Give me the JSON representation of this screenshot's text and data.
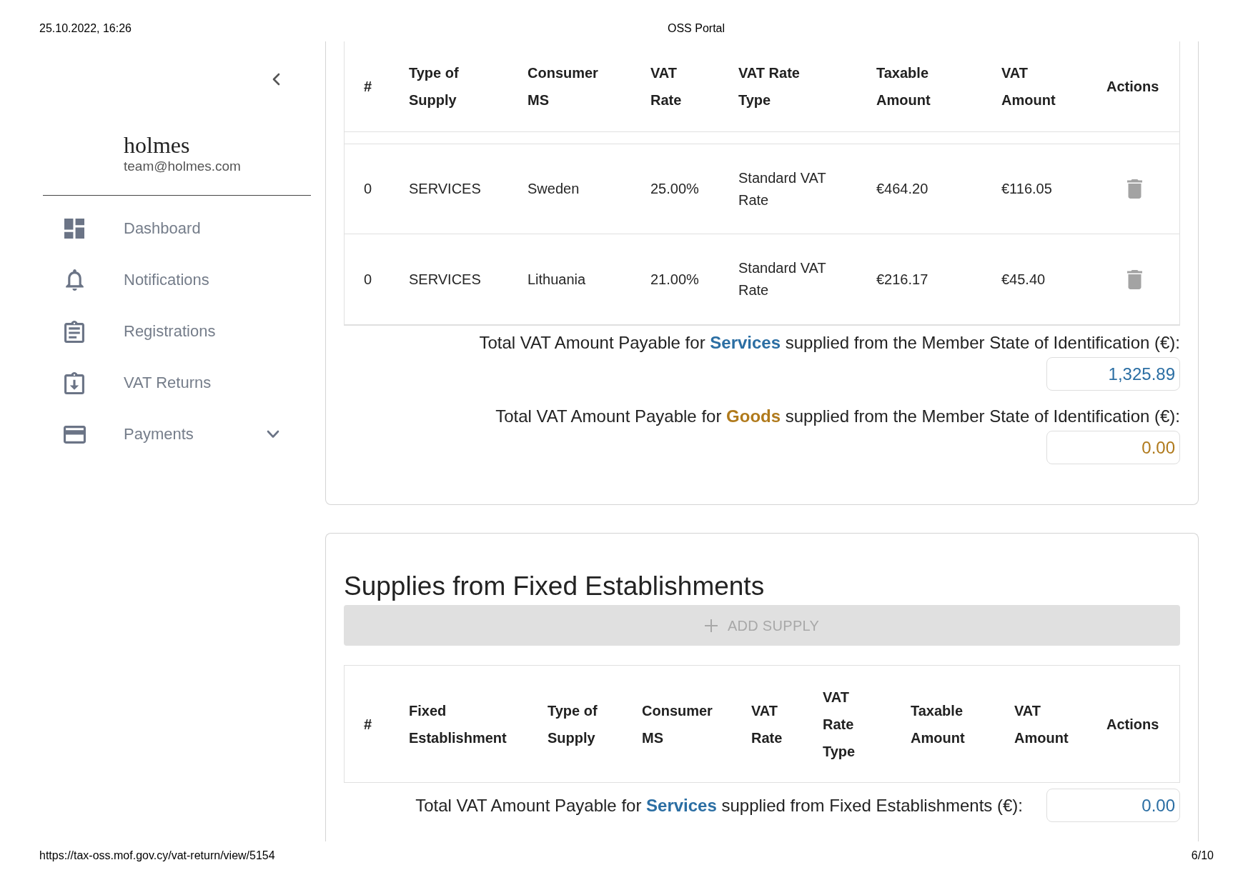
{
  "print_header": {
    "datetime": "25.10.2022, 16:26",
    "title": "OSS Portal"
  },
  "sidebar": {
    "user": {
      "name": "holmes",
      "email": "team@holmes.com"
    },
    "nav_items": [
      {
        "label": "Dashboard",
        "kind": "link"
      },
      {
        "label": "Notifications",
        "kind": "link"
      },
      {
        "label": "Registrations",
        "kind": "link"
      },
      {
        "label": "VAT Returns",
        "kind": "link"
      },
      {
        "label": "Payments",
        "kind": "group",
        "expanded": false
      }
    ]
  },
  "supplies_from_msi": {
    "table": {
      "columns": [
        "#",
        "Type of Supply",
        "Consumer MS",
        "VAT Rate",
        "VAT Rate Type",
        "Taxable Amount",
        "VAT Amount",
        "Actions"
      ],
      "rows": [
        [
          "0",
          "SERVICES",
          "Sweden",
          "25.00%",
          "Standard VAT Rate",
          "€464.20",
          "€116.05"
        ],
        [
          "0",
          "SERVICES",
          "Lithuania",
          "21.00%",
          "Standard VAT Rate",
          "€216.17",
          "€45.40"
        ]
      ]
    },
    "totals": [
      {
        "kind": "services",
        "label": "Total VAT Amount Payable for **Services** supplied from the Member State of Identification (€):",
        "value": "1,325.89"
      },
      {
        "kind": "goods",
        "label": "Total VAT Amount Payable for **Goods** supplied from the Member State of Identification (€):",
        "value": "0.00"
      }
    ]
  },
  "supplies_from_fixed_establishments": {
    "title": "Supplies from Fixed Establishments",
    "add_button": {
      "label": "ADD SUPPLY",
      "disabled": true
    },
    "table": {
      "columns": [
        "#",
        "Fixed Establishment",
        "Type of Supply",
        "Consumer MS",
        "VAT Rate",
        "VAT Rate Type",
        "Taxable Amount",
        "VAT Amount",
        "Actions"
      ]
    },
    "totals": [
      {
        "kind": "services",
        "label": "Total VAT Amount Payable for **Services** supplied from Fixed Establishments (€):",
        "value": "0.00"
      }
    ]
  },
  "print_footer": {
    "url": "https://tax-oss.mof.gov.cy/vat-return/view/5154",
    "page": "6/10"
  }
}
